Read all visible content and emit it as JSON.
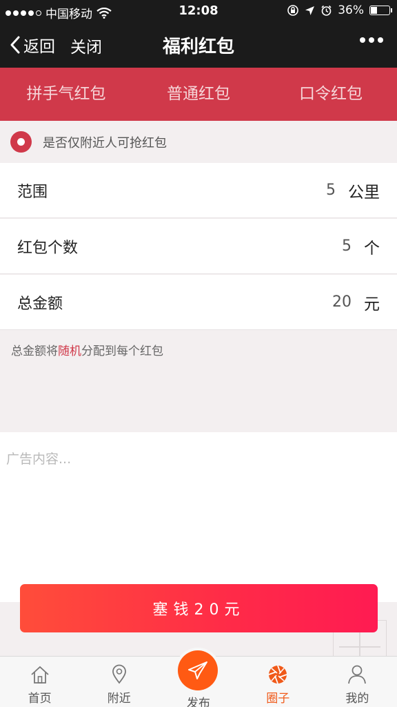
{
  "status_bar": {
    "carrier": "中国移动",
    "time": "12:08",
    "battery": "36%",
    "battery_level": 0.36
  },
  "nav": {
    "back_label": "返回",
    "close_label": "关闭",
    "title": "福利红包"
  },
  "tabs": [
    {
      "label": "拼手气红包",
      "active": true
    },
    {
      "label": "普通红包",
      "active": false
    },
    {
      "label": "口令红包",
      "active": false
    }
  ],
  "nearby_option": {
    "label": "是否仅附近人可抢红包",
    "checked": true
  },
  "form": {
    "range": {
      "label": "范围",
      "value": "5",
      "unit": "公里"
    },
    "count": {
      "label": "红包个数",
      "value": "5",
      "unit": "个"
    },
    "amount": {
      "label": "总金额",
      "value": "20",
      "unit": "元"
    }
  },
  "hint": {
    "prefix": "总金额将",
    "accent": "随机",
    "suffix": "分配到每个红包"
  },
  "ad": {
    "placeholder": "广告内容..."
  },
  "pay_button": {
    "label": "塞钱20元"
  },
  "tabbar": [
    {
      "label": "首页",
      "icon": "home-icon",
      "active": false
    },
    {
      "label": "附近",
      "icon": "location-pin-icon",
      "active": false
    },
    {
      "label": "发布",
      "icon": "paper-plane-icon",
      "active": false
    },
    {
      "label": "圈子",
      "icon": "aperture-icon",
      "active": true
    },
    {
      "label": "我的",
      "icon": "user-icon",
      "active": false
    }
  ],
  "colors": {
    "accent_red": "#d0394a",
    "active_tab_text": "#f7c46d",
    "tabbar_active": "#f05a1a",
    "publish_orange": "#ff5a13"
  }
}
